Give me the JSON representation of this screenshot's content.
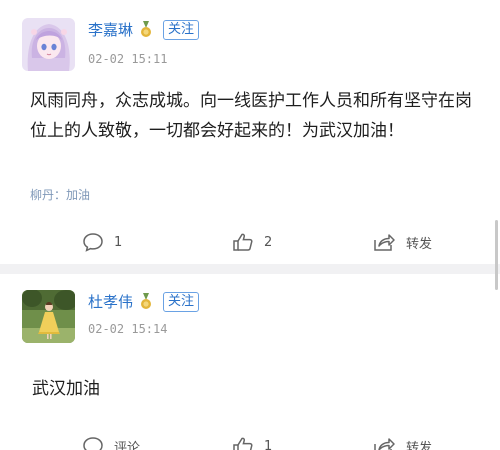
{
  "posts": [
    {
      "username": "李嘉琳",
      "follow_label": "关注",
      "timestamp": "02-02 15:11",
      "body": "风雨同舟，众志成城。向一线医护工作人员和所有坚守在岗位上的人致敬，一切都会好起来的！为武汉加油！",
      "tag_line": "柳丹：加油",
      "comment_label": "1",
      "like_label": "2",
      "repost_label": "转发",
      "avatar_icon": "anime-girl-avatar",
      "badge_icon": "medal-icon"
    },
    {
      "username": "杜孝伟",
      "follow_label": "关注",
      "timestamp": "02-02 15:14",
      "body": "武汉加油",
      "comment_label": "评论",
      "like_label": "1",
      "repost_label": "转发",
      "avatar_icon": "yellow-dress-photo-avatar",
      "badge_icon": "medal-icon"
    }
  ],
  "colors": {
    "username": "#2a72c9",
    "follow_border": "#6aa2e4",
    "timestamp": "#9a9a9a",
    "tag_line": "#7f98b8",
    "divider": "#f1f1f3"
  }
}
